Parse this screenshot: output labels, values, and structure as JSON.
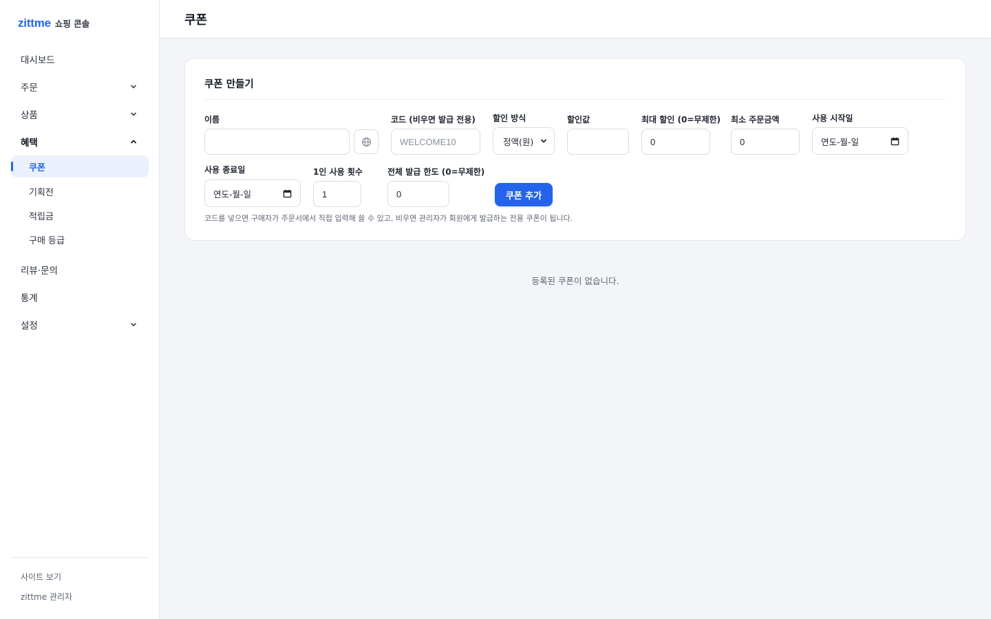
{
  "brand": {
    "logo": "zittme",
    "subtitle": "쇼핑 콘솔"
  },
  "sidebar": {
    "items": [
      {
        "label": "대시보드",
        "chevron": "none"
      },
      {
        "label": "주문",
        "chevron": "down"
      },
      {
        "label": "상품",
        "chevron": "down"
      },
      {
        "label": "혜택",
        "chevron": "up",
        "expanded": true
      },
      {
        "label": "리뷰·문의",
        "chevron": "none"
      },
      {
        "label": "통계",
        "chevron": "none"
      },
      {
        "label": "설정",
        "chevron": "down"
      }
    ],
    "benefit_sub": [
      {
        "label": "쿠폰",
        "current": true
      },
      {
        "label": "기획전"
      },
      {
        "label": "적립금"
      },
      {
        "label": "구매 등급"
      }
    ],
    "footer": {
      "view_site": "사이트 보기",
      "admin": "zittme 관리자"
    }
  },
  "header": {
    "title": "쿠폰"
  },
  "form": {
    "title": "쿠폰 만들기",
    "name": {
      "label": "이름",
      "value": ""
    },
    "code": {
      "label": "코드 (비우면 발급 전용)",
      "placeholder": "WELCOME10"
    },
    "discount_type": {
      "label": "할인 방식",
      "value": "정액(원)"
    },
    "discount_value": {
      "label": "할인값",
      "value": ""
    },
    "max_discount": {
      "label": "최대 할인 (0=무제한)",
      "value": "0"
    },
    "min_order": {
      "label": "최소 주문금액",
      "value": "0"
    },
    "start_date": {
      "label": "사용 시작일",
      "value": "연도-월-일"
    },
    "end_date": {
      "label": "사용 종료일",
      "value": "연도-월-일"
    },
    "per_user": {
      "label": "1인 사용 횟수",
      "value": "1"
    },
    "total_limit": {
      "label": "전체 발급 한도 (0=무제한)",
      "value": "0"
    },
    "submit_label": "쿠폰 추가",
    "hint": "코드를 넣으면 구매자가 주문서에서 직접 입력해 쓸 수 있고, 비우면 관리자가 회원에게 발급하는 전용 쿠폰이 됩니다."
  },
  "empty_state": "등록된 쿠폰이 없습니다.",
  "colors": {
    "accent": "#2563eb",
    "background": "#f3f5f9"
  },
  "icons": [
    "chevron-down-icon",
    "chevron-up-icon",
    "globe-icon",
    "calendar-icon",
    "select-chevron-icon"
  ]
}
